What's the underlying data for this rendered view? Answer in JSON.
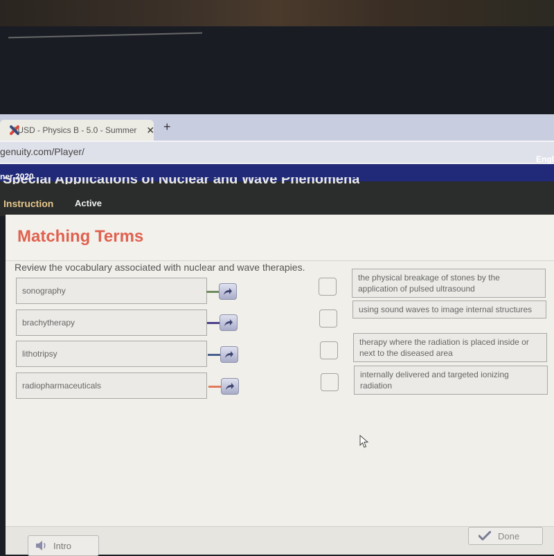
{
  "browser": {
    "tab_title": "FUSD - Physics B - 5.0 - Summer",
    "tab_close": "✕",
    "new_tab": "+",
    "url": "genuity.com/Player/"
  },
  "navbar": {
    "course_label": "ner 2020",
    "language_label": "Engl"
  },
  "lesson": {
    "title": "Special Applications of Nuclear and Wave Phenomena",
    "tabs": [
      {
        "label": "Instruction",
        "state": "current"
      },
      {
        "label": "Active",
        "state": "normal"
      }
    ]
  },
  "activity": {
    "title": "Matching Terms",
    "instructions": "Review the vocabulary associated with nuclear and wave therapies.",
    "terms": [
      {
        "label": "sonography",
        "connector_color": "#6f8a5e"
      },
      {
        "label": "brachytherapy",
        "connector_color": "#4b3f8c"
      },
      {
        "label": "lithotripsy",
        "connector_color": "#4a5f8e"
      },
      {
        "label": "radiopharmaceuticals",
        "connector_color": "#e07a5a"
      }
    ],
    "definitions": [
      {
        "label": "the physical breakage of stones by the application of pulsed ultrasound",
        "checked": false
      },
      {
        "label": "using sound waves to image internal structures",
        "checked": false
      },
      {
        "label": "therapy where the radiation is placed inside or next to the diseased area",
        "checked": false
      },
      {
        "label": "internally delivered and targeted ionizing radiation",
        "checked": false
      }
    ],
    "icons": {
      "arrow": "curved-arrow-icon",
      "speaker": "speaker-icon",
      "check": "checkmark-icon"
    }
  },
  "footer": {
    "intro_label": "Intro",
    "done_label": "Done"
  }
}
